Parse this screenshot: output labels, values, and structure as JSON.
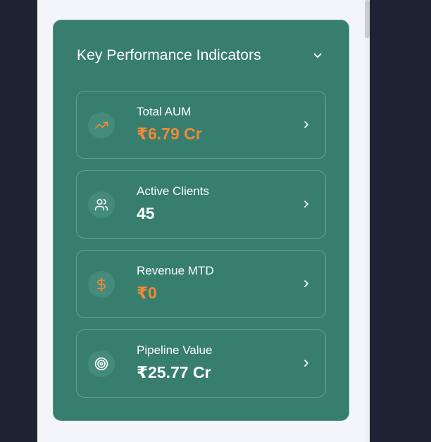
{
  "panel": {
    "title": "Key Performance Indicators"
  },
  "kpis": [
    {
      "label": "Total AUM",
      "value": "₹6.79 Cr",
      "icon": "trending-up-icon",
      "value_color": "#f08a35"
    },
    {
      "label": "Active Clients",
      "value": "45",
      "icon": "users-icon",
      "value_color": "#ffffff"
    },
    {
      "label": "Revenue MTD",
      "value": "₹0",
      "icon": "dollar-sign-icon",
      "value_color": "#f08a35"
    },
    {
      "label": "Pipeline Value",
      "value": "₹25.77 Cr",
      "icon": "target-icon",
      "value_color": "#ffffff"
    }
  ],
  "colors": {
    "panel_bg": "#387e6f",
    "accent_orange": "#f08a35",
    "page_bg": "#f3f5f8",
    "outer_bg": "#1e2333"
  }
}
